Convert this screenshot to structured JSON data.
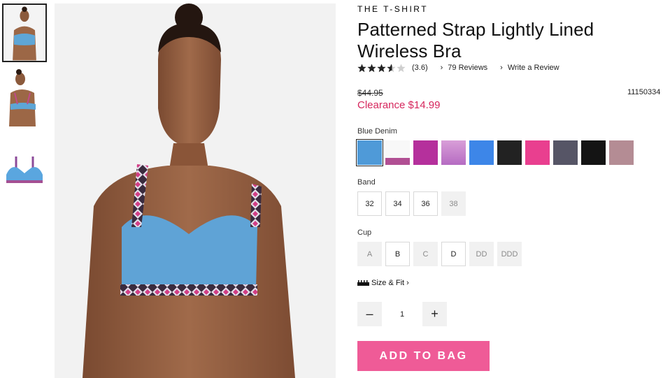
{
  "thumbnails": [
    {
      "view": "front-model",
      "selected": true
    },
    {
      "view": "back-model",
      "selected": false
    },
    {
      "view": "product-flat",
      "selected": false
    }
  ],
  "product": {
    "collection": "THE T-SHIRT",
    "title": "Patterned Strap Lightly Lined Wireless Bra",
    "rating": 3.6,
    "rating_text": "(3.6)",
    "reviews_link": "79 Reviews",
    "write_review_link": "Write a Review",
    "price_original": "$44.95",
    "price_sale": "Clearance $14.99",
    "sku": "11150334",
    "sale_color": "#d6275d"
  },
  "color": {
    "label": "Blue Denim",
    "swatches": [
      {
        "name": "blue-denim",
        "hex": "#4f9ad8",
        "selected": true
      },
      {
        "name": "white-pattern",
        "hex": "#f2f2f2",
        "selected": false
      },
      {
        "name": "magenta",
        "hex": "#b5309c",
        "selected": false
      },
      {
        "name": "logo-lilac",
        "hex": "#c98fd0",
        "selected": false
      },
      {
        "name": "cornflower-blue",
        "hex": "#3d86e8",
        "selected": false
      },
      {
        "name": "black",
        "hex": "#222222",
        "selected": false
      },
      {
        "name": "hot-pink",
        "hex": "#e93f8f",
        "selected": false
      },
      {
        "name": "charcoal-purple",
        "hex": "#565566",
        "selected": false
      },
      {
        "name": "black-2",
        "hex": "#141414",
        "selected": false
      },
      {
        "name": "mauve",
        "hex": "#b48c94",
        "selected": false
      }
    ]
  },
  "band": {
    "label": "Band",
    "options": [
      {
        "value": "32",
        "available": true
      },
      {
        "value": "34",
        "available": true
      },
      {
        "value": "36",
        "available": true
      },
      {
        "value": "38",
        "available": false
      }
    ]
  },
  "cup": {
    "label": "Cup",
    "options": [
      {
        "value": "A",
        "available": false
      },
      {
        "value": "B",
        "available": true
      },
      {
        "value": "C",
        "available": false
      },
      {
        "value": "D",
        "available": true
      },
      {
        "value": "DD",
        "available": false
      },
      {
        "value": "DDD",
        "available": false
      }
    ]
  },
  "size_fit": {
    "label": "Size & Fit",
    "chevron": "›"
  },
  "quantity": {
    "minus": "–",
    "value": "1",
    "plus": "+"
  },
  "cta": {
    "label": "ADD TO BAG",
    "color": "#ef5b97"
  },
  "icons": {
    "chevron": "›",
    "star": "star-icon",
    "ruler": "ruler-icon"
  }
}
